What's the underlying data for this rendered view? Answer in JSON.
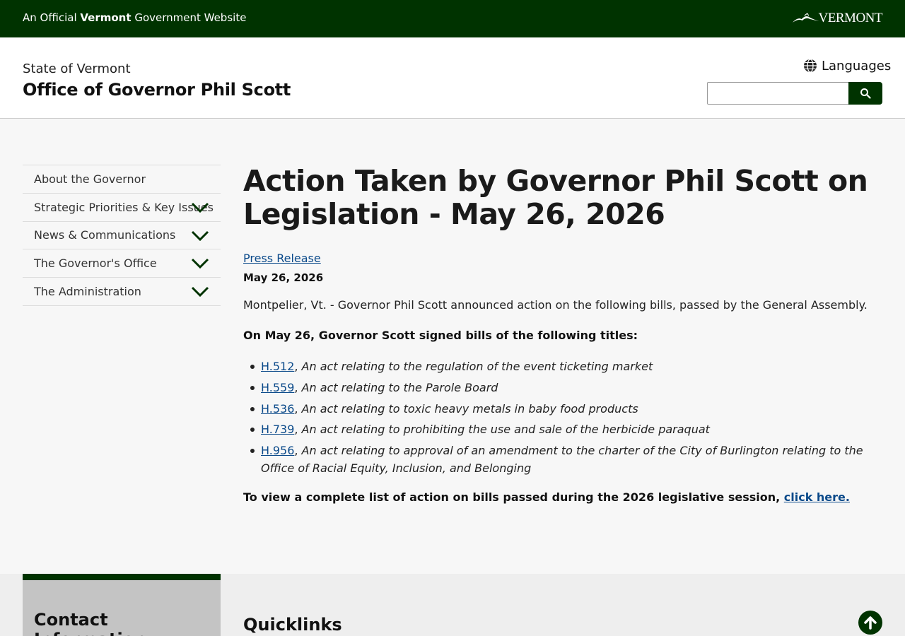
{
  "topbar": {
    "official_prefix": "An Official ",
    "official_bold": "Vermont",
    "official_suffix": " Government Website",
    "logo_text": "VERMONT",
    "logo_icon": "mountain-logo-icon"
  },
  "header": {
    "state": "State of Vermont",
    "office": "Office of Governor Phil Scott",
    "languages_label": "Languages",
    "languages_icon": "globe-icon",
    "search_placeholder": "",
    "search_icon": "search-icon"
  },
  "sidebar": {
    "items": [
      {
        "label": "About the Governor",
        "expandable": false
      },
      {
        "label": "Strategic Priorities & Key Issues",
        "expandable": true
      },
      {
        "label": "News & Communications",
        "expandable": true
      },
      {
        "label": "The Governor's Office",
        "expandable": true
      },
      {
        "label": "The Administration",
        "expandable": true
      }
    ]
  },
  "main": {
    "title": "Action Taken by Governor Phil Scott on Legislation - May 26, 2026",
    "press_release": "Press Release",
    "date": "May 26, 2026",
    "intro": "Montpelier, Vt. - Governor Phil Scott announced action on the following bills, passed by the General Assembly.",
    "signed_heading": "On May 26, Governor Scott signed bills of the following titles:",
    "bills": [
      {
        "id": "H.512",
        "title": "An act relating to the regulation of the event ticketing market"
      },
      {
        "id": "H.559",
        "title": "An act relating to the Parole Board"
      },
      {
        "id": "H.536",
        "title": "An act relating to toxic heavy metals in baby food products"
      },
      {
        "id": "H.739",
        "title": "An act relating to prohibiting the use and sale of the herbicide paraquat"
      },
      {
        "id": "H.956",
        "title": "An act relating to approval of an amendment to the charter of the City of Burlington relating to the Office of Racial Equity, Inclusion, and Belonging"
      }
    ],
    "view_all_text": "To view a complete list of action on bills passed during the 2026 legislative session, ",
    "view_all_link": "click here."
  },
  "footer": {
    "contact_heading": "Contact Information",
    "quicklinks_heading": "Quicklinks",
    "back_to_top_icon": "arrow-up-icon"
  },
  "colors": {
    "brand_green": "#003300",
    "link_blue": "#0b4a8a"
  }
}
